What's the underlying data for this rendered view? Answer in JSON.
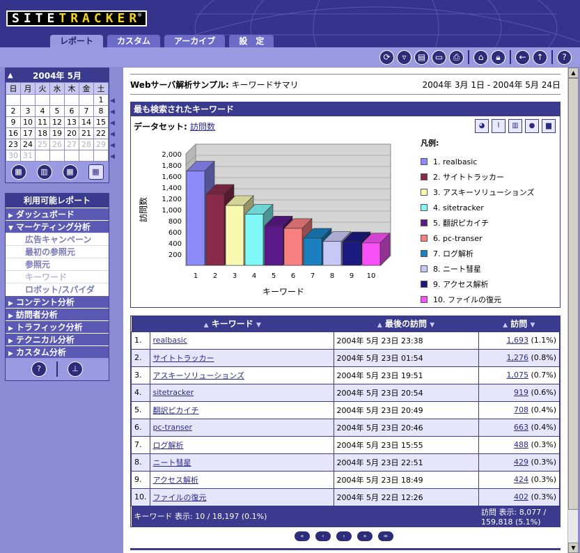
{
  "header": {
    "logo_a": "SITE",
    "logo_b": "TRACKER",
    "logo_reg": "®",
    "tabs": [
      {
        "label": "レポート",
        "active": true
      },
      {
        "label": "カスタム",
        "active": false
      },
      {
        "label": "アーカイブ",
        "active": false
      },
      {
        "label": "設　定",
        "active": false
      }
    ]
  },
  "toolbar": {
    "icons": [
      "refresh-icon",
      "filter-icon",
      "save-icon",
      "export-icon",
      "print-icon",
      "home-icon",
      "lock-icon",
      "back-icon",
      "up-icon",
      "help-icon"
    ]
  },
  "calendar": {
    "title": "2004年  5月",
    "weekdays": [
      "日",
      "月",
      "火",
      "水",
      "木",
      "金",
      "土"
    ],
    "weeks": [
      [
        "",
        "",
        "",
        "",
        "",
        "",
        "1"
      ],
      [
        "2",
        "3",
        "4",
        "5",
        "6",
        "7",
        "8"
      ],
      [
        "9",
        "10",
        "11",
        "12",
        "13",
        "14",
        "15"
      ],
      [
        "16",
        "17",
        "18",
        "19",
        "20",
        "21",
        "22"
      ],
      [
        "23",
        "24",
        "25",
        "26",
        "27",
        "28",
        "29"
      ],
      [
        "30",
        "31",
        "",
        "",
        "",
        "",
        ""
      ]
    ],
    "grayed_from": {
      "row": 4,
      "col": 2
    },
    "buttons": [
      "day-view-icon",
      "week-view-icon",
      "month-view-icon",
      "year-view-icon"
    ]
  },
  "reports": {
    "title": "利用可能レポート",
    "items": [
      {
        "label": "ダッシュボード",
        "type": "cat",
        "arrow": "▶"
      },
      {
        "label": "マーケティング分析",
        "type": "cat",
        "arrow": "▼"
      },
      {
        "label": "広告キャンペーン",
        "type": "sub"
      },
      {
        "label": "最初の参照元",
        "type": "sub"
      },
      {
        "label": "参照元",
        "type": "sub"
      },
      {
        "label": "キーワード",
        "type": "sub",
        "active": true
      },
      {
        "label": "ロボット/スパイダ",
        "type": "sub"
      },
      {
        "label": "コンテント分析",
        "type": "cat",
        "arrow": "▶"
      },
      {
        "label": "訪問者分析",
        "type": "cat",
        "arrow": "▶"
      },
      {
        "label": "トラフィック分析",
        "type": "cat",
        "arrow": "▶"
      },
      {
        "label": "テクニカル分析",
        "type": "cat",
        "arrow": "▶"
      },
      {
        "label": "カスタム分析",
        "type": "cat",
        "arrow": "▶"
      }
    ]
  },
  "main": {
    "title_bold": "Webサーバ解析サンプル:",
    "title_rest": " キーワードサマリ",
    "date_range": "2004年 3月 1日 - 2004年 5月 24日",
    "chart_header": "最も検索されたキーワード",
    "dataset_label": "データセット:",
    "dataset_value": "訪問数",
    "legend_title": "凡例:"
  },
  "chart_data": {
    "type": "bar",
    "categories": [
      "1",
      "2",
      "3",
      "4",
      "5",
      "6",
      "7",
      "8",
      "9",
      "10"
    ],
    "values": [
      1693,
      1276,
      1075,
      919,
      708,
      663,
      488,
      429,
      424,
      402
    ],
    "colors": [
      "#8a8af8",
      "#8a2a4a",
      "#f8f8b0",
      "#80f8f8",
      "#5a1a8a",
      "#f88080",
      "#1a80c0",
      "#c8c8f8",
      "#1a1a80",
      "#f850f8"
    ],
    "legend": [
      "1. realbasic",
      "2. サイトトラッカー",
      "3. アスキーソリューションズ",
      "4. sitetracker",
      "5. 翻訳ピカイチ",
      "6. pc-transer",
      "7. ログ解析",
      "8. ニート彗星",
      "9. アクセス解析",
      "10. ファイルの復元"
    ],
    "xlabel": "キーワード",
    "ylabel": "訪問数",
    "yticks": [
      "200",
      "400",
      "600",
      "800",
      "1,000",
      "1,200",
      "1,400",
      "1,600",
      "1,800",
      "2,000"
    ],
    "ylim": [
      0,
      2000
    ]
  },
  "table": {
    "headers": [
      "キーワード",
      "最後の訪問",
      "訪問"
    ],
    "rows": [
      {
        "n": "1.",
        "kw": "realbasic",
        "last": "2004年 5月 23日 23:38",
        "v": "1,693",
        "p": " (1.1%)"
      },
      {
        "n": "2.",
        "kw": "サイトトラッカー",
        "last": "2004年 5月 23日 01:54",
        "v": "1,276",
        "p": " (0.8%)"
      },
      {
        "n": "3.",
        "kw": "アスキーソリューションズ",
        "last": "2004年 5月 23日 19:51",
        "v": "1,075",
        "p": " (0.7%)"
      },
      {
        "n": "4.",
        "kw": "sitetracker",
        "last": "2004年 5月 23日 20:54",
        "v": "919",
        "p": " (0.6%)"
      },
      {
        "n": "5.",
        "kw": "翻訳ピカイチ",
        "last": "2004年 5月 23日 20:49",
        "v": "708",
        "p": " (0.4%)"
      },
      {
        "n": "6.",
        "kw": "pc-transer",
        "last": "2004年 5月 23日 20:46",
        "v": "663",
        "p": " (0.4%)"
      },
      {
        "n": "7.",
        "kw": "ログ解析",
        "last": "2004年 5月 23日 15:55",
        "v": "488",
        "p": " (0.3%)"
      },
      {
        "n": "8.",
        "kw": "ニート彗星",
        "last": "2004年 5月 23日 22:51",
        "v": "429",
        "p": " (0.3%)"
      },
      {
        "n": "9.",
        "kw": "アクセス解析",
        "last": "2004年 5月 23日 18:49",
        "v": "424",
        "p": " (0.3%)"
      },
      {
        "n": "10.",
        "kw": "ファイルの復元",
        "last": "2004年 5月 22日 12:26",
        "v": "402",
        "p": " (0.3%)"
      }
    ],
    "footer_left": "キーワード 表示: 10 / 18,197 (0.1%)",
    "footer_right": "訪問 表示: 8,077 / 159,818 (5.1%)"
  },
  "pager": [
    "first-page-icon",
    "prev-page-icon",
    "next-page-icon",
    "last-page-icon",
    "all-pages-icon"
  ]
}
